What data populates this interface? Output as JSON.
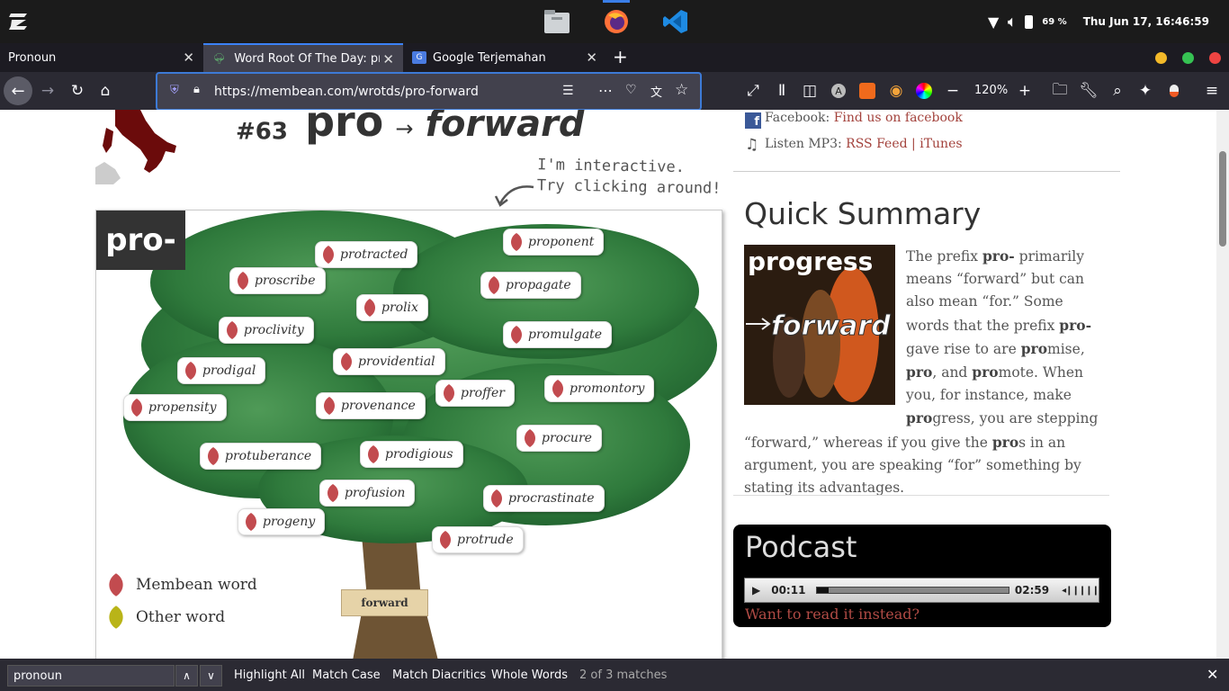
{
  "system_bar": {
    "battery": "69 %",
    "datetime": "Thu Jun 17, 16:46:59",
    "apps": [
      "files-icon",
      "firefox-icon",
      "vscode-icon"
    ]
  },
  "tabs": [
    {
      "title": "Pronoun"
    },
    {
      "title": "Word Root Of The Day: pro"
    },
    {
      "title": "Google Terjemahan"
    }
  ],
  "navbar": {
    "url": "https://membean.com/wrotds/pro-forward",
    "zoom": "120%"
  },
  "page": {
    "number": "#63",
    "root": "pro",
    "arrow": "→",
    "meaning": "forward",
    "interactive_note_1": "I'm interactive.",
    "interactive_note_2": "Try clicking around!",
    "root_label": "pro-",
    "signpost": "forward",
    "legend": {
      "membean": "Membean word",
      "other": "Other word"
    },
    "words": [
      "protracted",
      "proponent",
      "proscribe",
      "propagate",
      "prolix",
      "proclivity",
      "promulgate",
      "prodigal",
      "providential",
      "promontory",
      "propensity",
      "provenance",
      "proffer",
      "procure",
      "protuberance",
      "prodigious",
      "profusion",
      "procrastinate",
      "progeny",
      "protrude"
    ]
  },
  "sidebar": {
    "facebook_label": "Facebook:",
    "facebook_link": "Find us on facebook",
    "mp3_label": "Listen MP3:",
    "rss": "RSS Feed",
    "sep": "|",
    "itunes": "iTunes",
    "quick_summary": "Quick Summary",
    "image_top": "progress",
    "image_bottom": "forward",
    "summary": {
      "p1": "The prefix ",
      "b1": "pro-",
      "p2": " primarily means “forward” but can also mean “for.” Some words that the prefix ",
      "b2": "pro-",
      "p3": " gave rise to are ",
      "b3": "pro",
      "p4": "mise, ",
      "b4": "pro",
      "p5": ", and ",
      "b5": "pro",
      "p6": "mote. When you, for instance, make ",
      "b6": "pro",
      "p7": "gress, you are stepping “forward,” whereas if you give the ",
      "b7": "pro",
      "p8": "s in an argument, you are speaking “for” something by stating its advantages."
    },
    "podcast_title": "Podcast",
    "time_current": "00:11",
    "time_total": "02:59",
    "progress_fraction": 0.06,
    "read_link": "Want to read it instead?"
  },
  "findbar": {
    "query": "pronoun",
    "highlight_all": "Highlight All",
    "match_case": "Match Case",
    "match_diacritics": "Match Diacritics",
    "whole_words": "Whole Words",
    "status": "2 of 3 matches"
  }
}
